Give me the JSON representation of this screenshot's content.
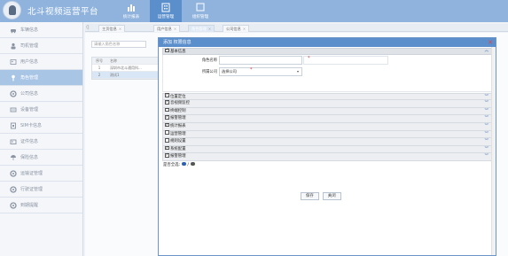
{
  "app": {
    "title": "北斗视频运营平台"
  },
  "top_nav": [
    {
      "label": "统计报表",
      "icon": "bar-chart-icon",
      "active": false
    },
    {
      "label": "运营管理",
      "icon": "building-icon",
      "active": true
    },
    {
      "label": "组织管理",
      "icon": "window-icon",
      "active": false
    }
  ],
  "sidebar": {
    "items": [
      {
        "label": "车辆信息",
        "icon": "car-icon",
        "active": false
      },
      {
        "label": "司机管理",
        "icon": "driver-icon",
        "active": false
      },
      {
        "label": "用户信息",
        "icon": "user-icon",
        "active": false
      },
      {
        "label": "角色管理",
        "icon": "key-icon",
        "active": true
      },
      {
        "label": "公司信息",
        "icon": "gear-icon",
        "active": false
      },
      {
        "label": "设备管理",
        "icon": "device-icon",
        "active": false
      },
      {
        "label": "SIM卡信息",
        "icon": "sim-icon",
        "active": false
      },
      {
        "label": "证件信息",
        "icon": "id-card-icon",
        "active": false
      },
      {
        "label": "保险信息",
        "icon": "umbrella-icon",
        "active": false
      },
      {
        "label": "运输证管理",
        "icon": "gear-icon",
        "active": false
      },
      {
        "label": "行驶证管理",
        "icon": "gear-icon",
        "active": false
      },
      {
        "label": "到期提醒",
        "icon": "gear-icon",
        "active": false
      }
    ]
  },
  "tabs": [
    {
      "label": "主页信息",
      "active": false
    },
    {
      "label": "用户信息",
      "active": false
    },
    {
      "label": "角色管理",
      "active": true
    },
    {
      "label": "公司信息",
      "active": false
    }
  ],
  "list": {
    "search_placeholder": "请输入角色名称",
    "headers": [
      "序号",
      "名称"
    ],
    "rows": [
      {
        "index": "1",
        "name": "深圳市北斗通用科...",
        "selected": false
      },
      {
        "index": "2",
        "name": "测试1",
        "selected": true
      }
    ]
  },
  "dialog": {
    "title": "添加    权限信息",
    "basic_section": "基本信息",
    "fields": {
      "role_name_label": "角色名称",
      "role_name_value": "",
      "company_label": "所属公司",
      "company_value": "选择公司"
    },
    "required_mark": "*",
    "permissions": [
      {
        "label": "位置定位",
        "checked": true
      },
      {
        "label": "音视频监控",
        "checked": true
      },
      {
        "label": "终端控制",
        "checked": false
      },
      {
        "label": "报警管理",
        "checked": true
      },
      {
        "label": "统计报表",
        "checked": true
      },
      {
        "label": "运营管理",
        "checked": false
      },
      {
        "label": "规则设置",
        "checked": false
      },
      {
        "label": "系统配置",
        "checked": true
      },
      {
        "label": "报警管理",
        "checked": true
      }
    ],
    "select_all_label": "是否全选:",
    "select_all_divider": "/",
    "save_label": "保存",
    "close_label": "关闭"
  }
}
